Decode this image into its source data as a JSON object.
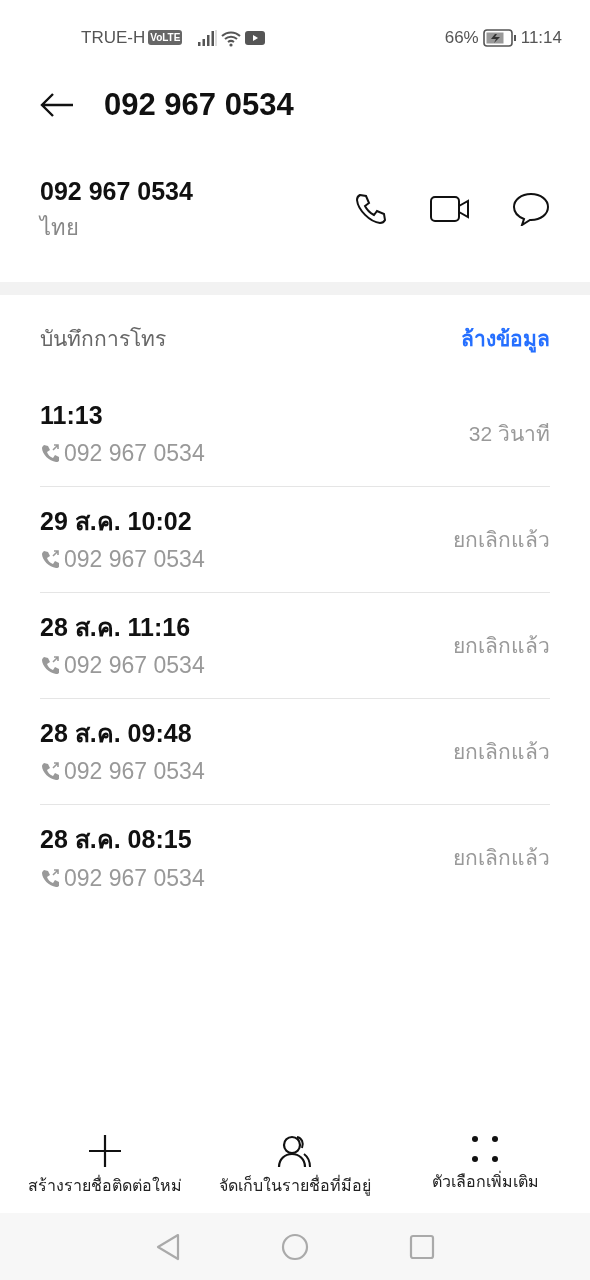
{
  "status_bar": {
    "carrier": "TRUE-H",
    "volte": "VoLTE",
    "battery": "66%",
    "time": "11:14"
  },
  "header": {
    "title": "092 967 0534"
  },
  "contact": {
    "number": "092 967 0534",
    "country": "ไทย"
  },
  "call_log": {
    "title": "บันทึกการโทร",
    "clear": "ล้างข้อมูล",
    "rows": [
      {
        "time": "11:13",
        "number": "092 967 0534",
        "result": "32 วินาที"
      },
      {
        "time": "29 ส.ค. 10:02",
        "number": "092 967 0534",
        "result": "ยกเลิกแล้ว"
      },
      {
        "time": "28 ส.ค. 11:16",
        "number": "092 967 0534",
        "result": "ยกเลิกแล้ว"
      },
      {
        "time": "28 ส.ค. 09:48",
        "number": "092 967 0534",
        "result": "ยกเลิกแล้ว"
      },
      {
        "time": "28 ส.ค. 08:15",
        "number": "092 967 0534",
        "result": "ยกเลิกแล้ว"
      }
    ]
  },
  "bottom_actions": [
    {
      "kind": "add",
      "label": "สร้างรายชื่อติดต่อใหม่"
    },
    {
      "kind": "contacts",
      "label": "จัดเก็บในรายชื่อที่มีอยู่"
    },
    {
      "kind": "more",
      "label": "ตัวเลือกเพิ่มเติม"
    }
  ]
}
